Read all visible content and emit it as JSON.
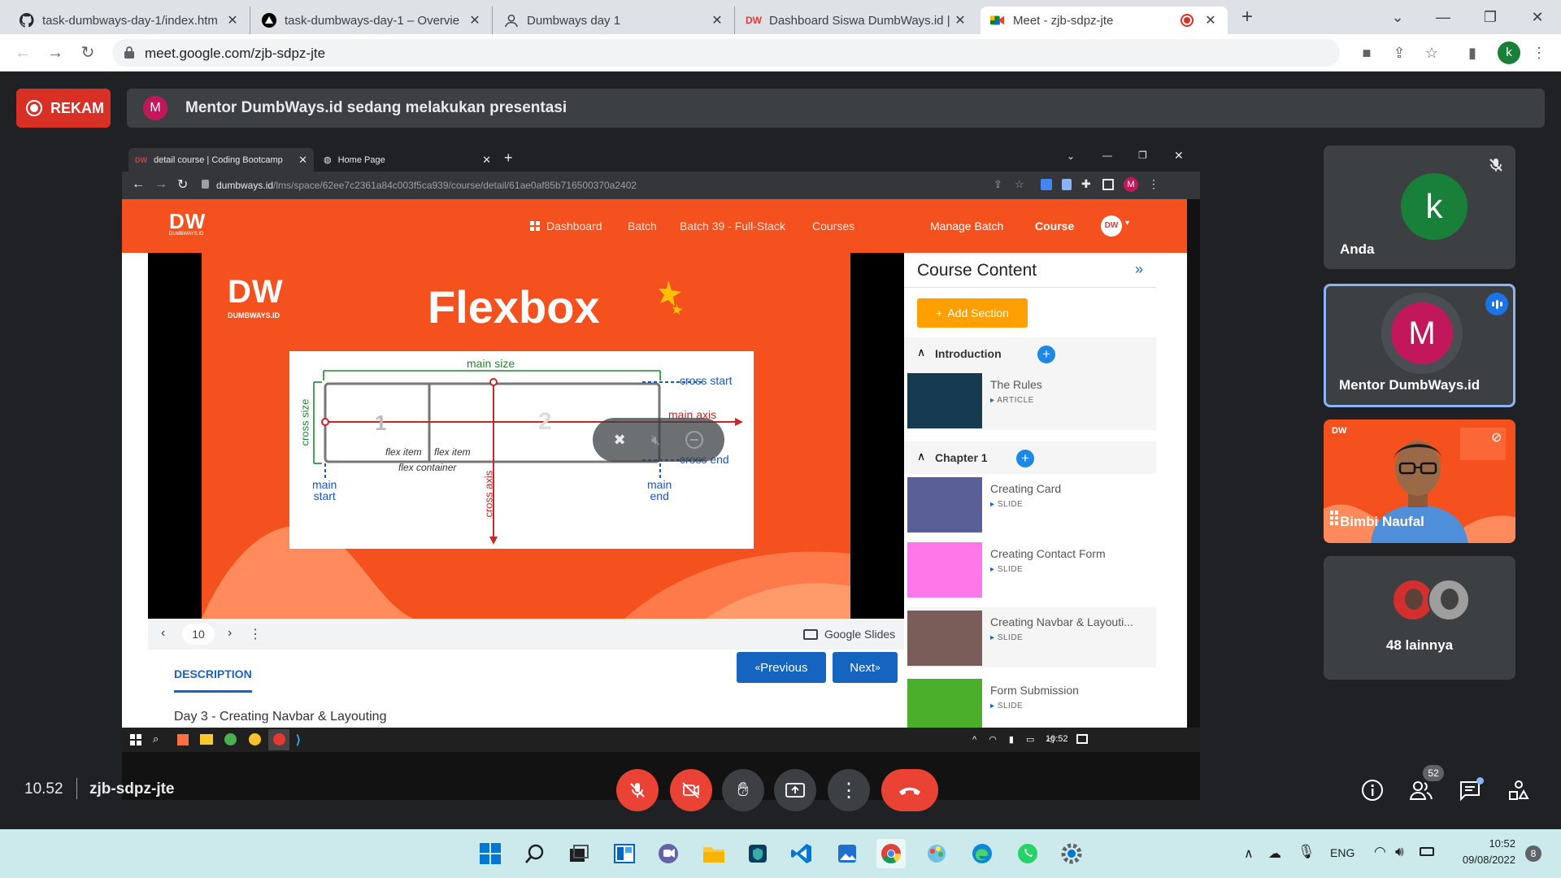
{
  "browser": {
    "tabs": [
      {
        "title": "task-dumbways-day-1/index.htm",
        "icon": "github-icon"
      },
      {
        "title": "task-dumbways-day-1 – Overvie",
        "icon": "vercel-icon"
      },
      {
        "title": "Dumbways day 1",
        "icon": "person-icon"
      },
      {
        "title": "Dashboard Siswa DumbWays.id |",
        "icon": "dumbways-icon"
      },
      {
        "title": "Meet - zjb-sdpz-jte",
        "icon": "meet-icon"
      }
    ],
    "url": "meet.google.com/zjb-sdpz-jte",
    "profile_initial": "k"
  },
  "meet": {
    "record_label": "REKAM",
    "banner": {
      "avatar": "M",
      "text": "Mentor DumbWays.id sedang melakukan presentasi"
    },
    "clock": "10.52",
    "meeting_code": "zjb-sdpz-jte",
    "participants_count": "52",
    "tiles": [
      {
        "name": "Anda",
        "initial": "k",
        "avatar_color": "#188038"
      },
      {
        "name": "Mentor DumbWays.id",
        "initial": "M",
        "avatar_color": "#c2185b"
      },
      {
        "name": "Bimbi Naufal"
      },
      {
        "name": "48 lainnya"
      }
    ]
  },
  "presentation": {
    "tabs": [
      {
        "title": "detail course | Coding Bootcamp"
      },
      {
        "title": "Home Page"
      }
    ],
    "url_host": "dumbways.id",
    "url_path": "/lms/space/62ee7c2361a84c003f5ca939/course/detail/61ae0af85b716500370a2402",
    "profile_initial": "M",
    "site": {
      "logo": "DW",
      "logo_sub": "DUMBWAYS.ID",
      "nav": [
        "Dashboard",
        "Batch",
        "Batch 39 - Full-Stack",
        "Courses"
      ],
      "manage_batch": "Manage Batch",
      "course": "Course"
    },
    "slide": {
      "title": "Flexbox",
      "logo_sub": "DUMBWAYS.ID",
      "labels": {
        "main_size": "main size",
        "cross_start": "cross start",
        "main_axis": "main axis",
        "cross_size": "cross size",
        "cross_end": "cross end",
        "flex_item": "flex item",
        "flex_container": "flex container",
        "main": "main",
        "start": "start",
        "end": "end",
        "cross_axis": "cross axis",
        "item_one": "1",
        "item_two": "2"
      }
    },
    "slide_controls": {
      "page": "10",
      "provider": "Google Slides"
    },
    "description_tab": "DESCRIPTION",
    "prev_label": "Previous",
    "next_label": "Next",
    "description_text": "Day 3 - Creating Navbar & Layouting",
    "course_content": {
      "title": "Course Content",
      "add_section": "Add Section",
      "sections": [
        {
          "title": "Introduction",
          "items": [
            {
              "name": "The Rules",
              "type": "ARTICLE",
              "color": "#163a4f"
            }
          ]
        },
        {
          "title": "Chapter 1",
          "items": [
            {
              "name": "Creating Card",
              "type": "SLIDE",
              "color": "#5b5f97"
            },
            {
              "name": "Creating Contact Form",
              "type": "SLIDE",
              "color": "#ff77e9"
            },
            {
              "name": "Creating Navbar & Layouti...",
              "type": "SLIDE",
              "color": "#7a5c58"
            },
            {
              "name": "Form Submission",
              "type": "SLIDE",
              "color": "#4caf2b"
            }
          ]
        }
      ]
    },
    "taskbar_time": "10:52"
  },
  "windows_taskbar": {
    "language": "ENG",
    "time": "10:52",
    "date": "09/08/2022",
    "notifications": "8"
  }
}
